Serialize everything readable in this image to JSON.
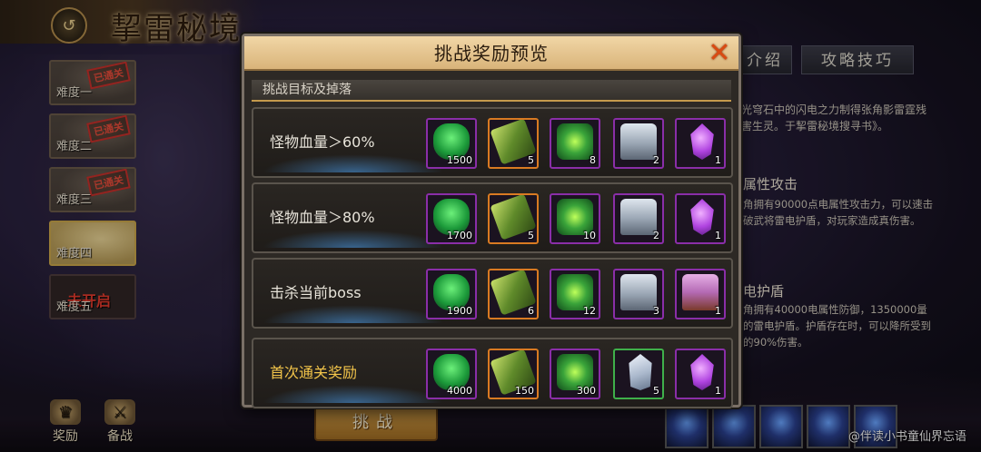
{
  "header": {
    "title": "挈雷秘境"
  },
  "difficulties": [
    {
      "label": "难度一",
      "stamp": "已通关"
    },
    {
      "label": "难度二",
      "stamp": "已通关"
    },
    {
      "label": "难度三",
      "stamp": "已通关"
    },
    {
      "label": "难度四",
      "stamp": ""
    },
    {
      "label": "难度五",
      "locked_text": "未开启"
    }
  ],
  "bottom_buttons": {
    "rewards": "奖励",
    "prep": "备战"
  },
  "challenge_button": "挑战",
  "right_tabs": {
    "intro": "介绍",
    "tips": "攻略技巧"
  },
  "right_panel": {
    "desc": "光穹石中的闪电之力制得张角影雷霆残害生灵。于挈雷秘境搜寻书》。",
    "section1_title": "属性攻击",
    "section1_text": "角拥有90000点电属性攻击力，可以速击破武将雷电护盾，对玩家造成真伤害。",
    "section2_title": "电护盾",
    "section2_text": "角拥有40000电属性防御，1350000量的雷电护盾。护盾存在时，可以降所受到的90%伤害。"
  },
  "watermark": "@伴读小书童仙界忘语",
  "modal": {
    "title": "挑战奖励预览",
    "section": "挑战目标及掉落",
    "rows": [
      {
        "condition": "怪物血量＞60%",
        "items": [
          {
            "type": "book",
            "qty": "1500",
            "frame": "purple"
          },
          {
            "type": "scroll",
            "qty": "5",
            "frame": "orange"
          },
          {
            "type": "pack",
            "qty": "8",
            "frame": "purple"
          },
          {
            "type": "chest",
            "qty": "2",
            "frame": "purple"
          },
          {
            "type": "gem",
            "qty": "1",
            "frame": "purple"
          }
        ]
      },
      {
        "condition": "怪物血量＞80%",
        "items": [
          {
            "type": "book",
            "qty": "1700",
            "frame": "purple"
          },
          {
            "type": "scroll",
            "qty": "5",
            "frame": "orange"
          },
          {
            "type": "pack",
            "qty": "10",
            "frame": "purple"
          },
          {
            "type": "chest",
            "qty": "2",
            "frame": "purple"
          },
          {
            "type": "gem",
            "qty": "1",
            "frame": "purple"
          }
        ]
      },
      {
        "condition": "击杀当前boss",
        "items": [
          {
            "type": "book",
            "qty": "1900",
            "frame": "purple"
          },
          {
            "type": "scroll",
            "qty": "6",
            "frame": "orange"
          },
          {
            "type": "pack",
            "qty": "12",
            "frame": "purple"
          },
          {
            "type": "chest",
            "qty": "3",
            "frame": "purple"
          },
          {
            "type": "chest-gold",
            "qty": "1",
            "frame": "purple"
          }
        ]
      },
      {
        "condition": "首次通关奖励",
        "items": [
          {
            "type": "book",
            "qty": "4000",
            "frame": "purple"
          },
          {
            "type": "scroll",
            "qty": "150",
            "frame": "orange"
          },
          {
            "type": "pack",
            "qty": "300",
            "frame": "purple"
          },
          {
            "type": "crystal",
            "qty": "5",
            "frame": "green"
          },
          {
            "type": "gem",
            "qty": "1",
            "frame": "purple"
          }
        ]
      }
    ]
  }
}
